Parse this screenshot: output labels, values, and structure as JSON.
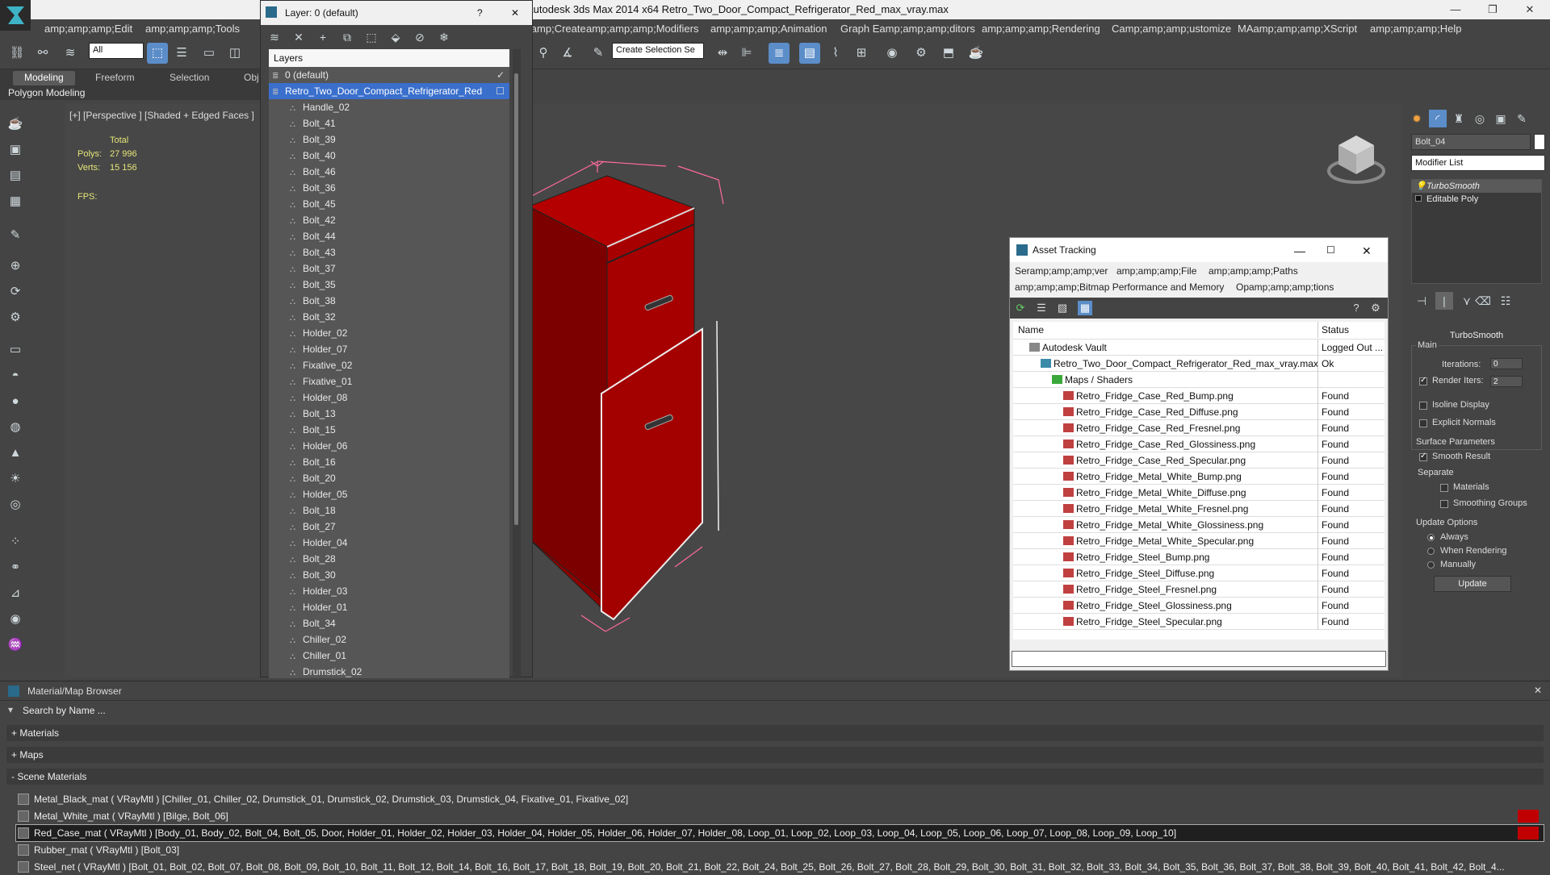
{
  "window": {
    "title": "Autodesk 3ds Max  2014 x64     Retro_Two_Door_Compact_Refrigerator_Red_max_vray.max",
    "minimize": "—",
    "restore": "❐",
    "close": "✕"
  },
  "menu": {
    "items": [
      "amp;amp;amp;Edit",
      "amp;amp;amp;Tools",
      "amp;amp;amp;Create",
      "amp;amp;amp;Modifiers",
      "amp;amp;amp;Animation",
      "Graph Eamp;amp;amp;ditors",
      "amp;amp;amp;Rendering",
      "Camp;amp;amp;ustomize",
      "MAamp;amp;amp;XScript",
      "amp;amp;amp;Help"
    ]
  },
  "toolbar": {
    "filter_value": "All",
    "selection_set_placeholder": "Create Selection Se"
  },
  "ribbon": {
    "tabs": [
      "Modeling",
      "Freeform",
      "Selection",
      "Obj"
    ],
    "panel_label": "Polygon Modeling"
  },
  "viewport": {
    "label": "[+] [Perspective ] [Shaded + Edged Faces ]",
    "total_label": "Total",
    "polys_label": "Polys:",
    "polys_value": "27 996",
    "verts_label": "Verts:",
    "verts_value": "15 156",
    "fps_label": "FPS:"
  },
  "layer_window": {
    "title": "Layer: 0 (default)",
    "help": "?",
    "close": "✕",
    "column_header": "Layers",
    "layers": [
      {
        "name": "0 (default)",
        "level": 0,
        "selected": false,
        "mark": "✓"
      },
      {
        "name": "Retro_Two_Door_Compact_Refrigerator_Red",
        "level": 0,
        "selected": true,
        "mark": "☐"
      },
      {
        "name": "Handle_02",
        "level": 1
      },
      {
        "name": "Bolt_41",
        "level": 1
      },
      {
        "name": "Bolt_39",
        "level": 1
      },
      {
        "name": "Bolt_40",
        "level": 1
      },
      {
        "name": "Bolt_46",
        "level": 1
      },
      {
        "name": "Bolt_36",
        "level": 1
      },
      {
        "name": "Bolt_45",
        "level": 1
      },
      {
        "name": "Bolt_42",
        "level": 1
      },
      {
        "name": "Bolt_44",
        "level": 1
      },
      {
        "name": "Bolt_43",
        "level": 1
      },
      {
        "name": "Bolt_37",
        "level": 1
      },
      {
        "name": "Bolt_35",
        "level": 1
      },
      {
        "name": "Bolt_38",
        "level": 1
      },
      {
        "name": "Bolt_32",
        "level": 1
      },
      {
        "name": "Holder_02",
        "level": 1
      },
      {
        "name": "Holder_07",
        "level": 1
      },
      {
        "name": "Fixative_02",
        "level": 1
      },
      {
        "name": "Fixative_01",
        "level": 1
      },
      {
        "name": "Holder_08",
        "level": 1
      },
      {
        "name": "Bolt_13",
        "level": 1
      },
      {
        "name": "Bolt_15",
        "level": 1
      },
      {
        "name": "Holder_06",
        "level": 1
      },
      {
        "name": "Bolt_16",
        "level": 1
      },
      {
        "name": "Bolt_20",
        "level": 1
      },
      {
        "name": "Holder_05",
        "level": 1
      },
      {
        "name": "Bolt_18",
        "level": 1
      },
      {
        "name": "Bolt_27",
        "level": 1
      },
      {
        "name": "Holder_04",
        "level": 1
      },
      {
        "name": "Bolt_28",
        "level": 1
      },
      {
        "name": "Bolt_30",
        "level": 1
      },
      {
        "name": "Holder_03",
        "level": 1
      },
      {
        "name": "Holder_01",
        "level": 1
      },
      {
        "name": "Bolt_34",
        "level": 1
      },
      {
        "name": "Chiller_02",
        "level": 1
      },
      {
        "name": "Chiller_01",
        "level": 1
      },
      {
        "name": "Drumstick_02",
        "level": 1
      }
    ]
  },
  "asset_tracking": {
    "title": "Asset Tracking",
    "menu_row1": [
      "Seramp;amp;amp;ver",
      "amp;amp;amp;File",
      "amp;amp;amp;Paths"
    ],
    "menu_row2": [
      "amp;amp;amp;Bitmap Performance and Memory",
      "Opamp;amp;amp;tions"
    ],
    "col_name": "Name",
    "col_status": "Status",
    "rows": [
      {
        "name": "Autodesk Vault",
        "status": "Logged Out ...",
        "indent": 1,
        "kind": "vault"
      },
      {
        "name": "Retro_Two_Door_Compact_Refrigerator_Red_max_vray.max",
        "status": "Ok",
        "indent": 2,
        "kind": "max"
      },
      {
        "name": "Maps / Shaders",
        "status": "",
        "indent": 3,
        "kind": "folder"
      },
      {
        "name": "Retro_Fridge_Case_Red_Bump.png",
        "status": "Found",
        "indent": 4,
        "kind": "png"
      },
      {
        "name": "Retro_Fridge_Case_Red_Diffuse.png",
        "status": "Found",
        "indent": 4,
        "kind": "png"
      },
      {
        "name": "Retro_Fridge_Case_Red_Fresnel.png",
        "status": "Found",
        "indent": 4,
        "kind": "png"
      },
      {
        "name": "Retro_Fridge_Case_Red_Glossiness.png",
        "status": "Found",
        "indent": 4,
        "kind": "png"
      },
      {
        "name": "Retro_Fridge_Case_Red_Specular.png",
        "status": "Found",
        "indent": 4,
        "kind": "png"
      },
      {
        "name": "Retro_Fridge_Metal_White_Bump.png",
        "status": "Found",
        "indent": 4,
        "kind": "png"
      },
      {
        "name": "Retro_Fridge_Metal_White_Diffuse.png",
        "status": "Found",
        "indent": 4,
        "kind": "png"
      },
      {
        "name": "Retro_Fridge_Metal_White_Fresnel.png",
        "status": "Found",
        "indent": 4,
        "kind": "png"
      },
      {
        "name": "Retro_Fridge_Metal_White_Glossiness.png",
        "status": "Found",
        "indent": 4,
        "kind": "png"
      },
      {
        "name": "Retro_Fridge_Metal_White_Specular.png",
        "status": "Found",
        "indent": 4,
        "kind": "png"
      },
      {
        "name": "Retro_Fridge_Steel_Bump.png",
        "status": "Found",
        "indent": 4,
        "kind": "png"
      },
      {
        "name": "Retro_Fridge_Steel_Diffuse.png",
        "status": "Found",
        "indent": 4,
        "kind": "png"
      },
      {
        "name": "Retro_Fridge_Steel_Fresnel.png",
        "status": "Found",
        "indent": 4,
        "kind": "png"
      },
      {
        "name": "Retro_Fridge_Steel_Glossiness.png",
        "status": "Found",
        "indent": 4,
        "kind": "png"
      },
      {
        "name": "Retro_Fridge_Steel_Specular.png",
        "status": "Found",
        "indent": 4,
        "kind": "png"
      }
    ]
  },
  "modify_panel": {
    "object_name": "Bolt_04",
    "modifier_list": "Modifier List",
    "stack": [
      "TurboSmooth",
      "Editable Poly"
    ],
    "rollout_title": "TurboSmooth",
    "main_label": "Main",
    "iterations_label": "Iterations:",
    "iterations_value": "0",
    "render_iters_label": "Render Iters:",
    "render_iters_value": "2",
    "isoline_label": "Isoline Display",
    "explicit_normals_label": "Explicit Normals",
    "surface_params_label": "Surface Parameters",
    "smooth_result_label": "Smooth Result",
    "separate_label": "Separate",
    "materials_label": "Materials",
    "smoothing_groups_label": "Smoothing Groups",
    "update_options_label": "Update Options",
    "always_label": "Always",
    "when_rendering_label": "When Rendering",
    "manually_label": "Manually",
    "update_button": "Update"
  },
  "material_browser": {
    "title": "Material/Map Browser",
    "close": "✕",
    "search_placeholder": "Search by Name ...",
    "sections": [
      "+ Materials",
      "+ Maps",
      "- Scene Materials"
    ],
    "materials": [
      {
        "text": "Metal_Black_mat  ( VRayMtl ) [Chiller_01, Chiller_02, Drumstick_01, Drumstick_02, Drumstick_03, Drumstick_04, Fixative_01, Fixative_02]",
        "selected": false,
        "swatch": false
      },
      {
        "text": "Metal_White_mat  ( VRayMtl ) [Bilge, Bolt_06]",
        "selected": false,
        "swatch": true
      },
      {
        "text": "Red_Case_mat  ( VRayMtl ) [Body_01, Body_02, Bolt_04, Bolt_05, Door, Holder_01, Holder_02, Holder_03, Holder_04, Holder_05, Holder_06, Holder_07, Holder_08, Loop_01, Loop_02, Loop_03, Loop_04, Loop_05, Loop_06, Loop_07, Loop_08, Loop_09, Loop_10]",
        "selected": true,
        "swatch": true
      },
      {
        "text": "Rubber_mat  ( VRayMtl ) [Bolt_03]",
        "selected": false,
        "swatch": false
      },
      {
        "text": "Steel_net  ( VRayMtl ) [Bolt_01, Bolt_02, Bolt_07, Bolt_08, Bolt_09, Bolt_10, Bolt_11, Bolt_12, Bolt_14, Bolt_16, Bolt_17, Bolt_18, Bolt_19, Bolt_20, Bolt_21, Bolt_22, Bolt_24, Bolt_25, Bolt_26, Bolt_27, Bolt_28, Bolt_29, Bolt_30, Bolt_31, Bolt_32, Bolt_33, Bolt_34, Bolt_35, Bolt_36, Bolt_37, Bolt_38, Bolt_39, Bolt_40, Bolt_41, Bolt_42, Bolt_4...",
        "selected": false,
        "swatch": false
      }
    ]
  },
  "colors": {
    "fridge_red": "#b00000",
    "selection_blue": "#3a6fcc",
    "accent_blue": "#5b8dc9"
  }
}
